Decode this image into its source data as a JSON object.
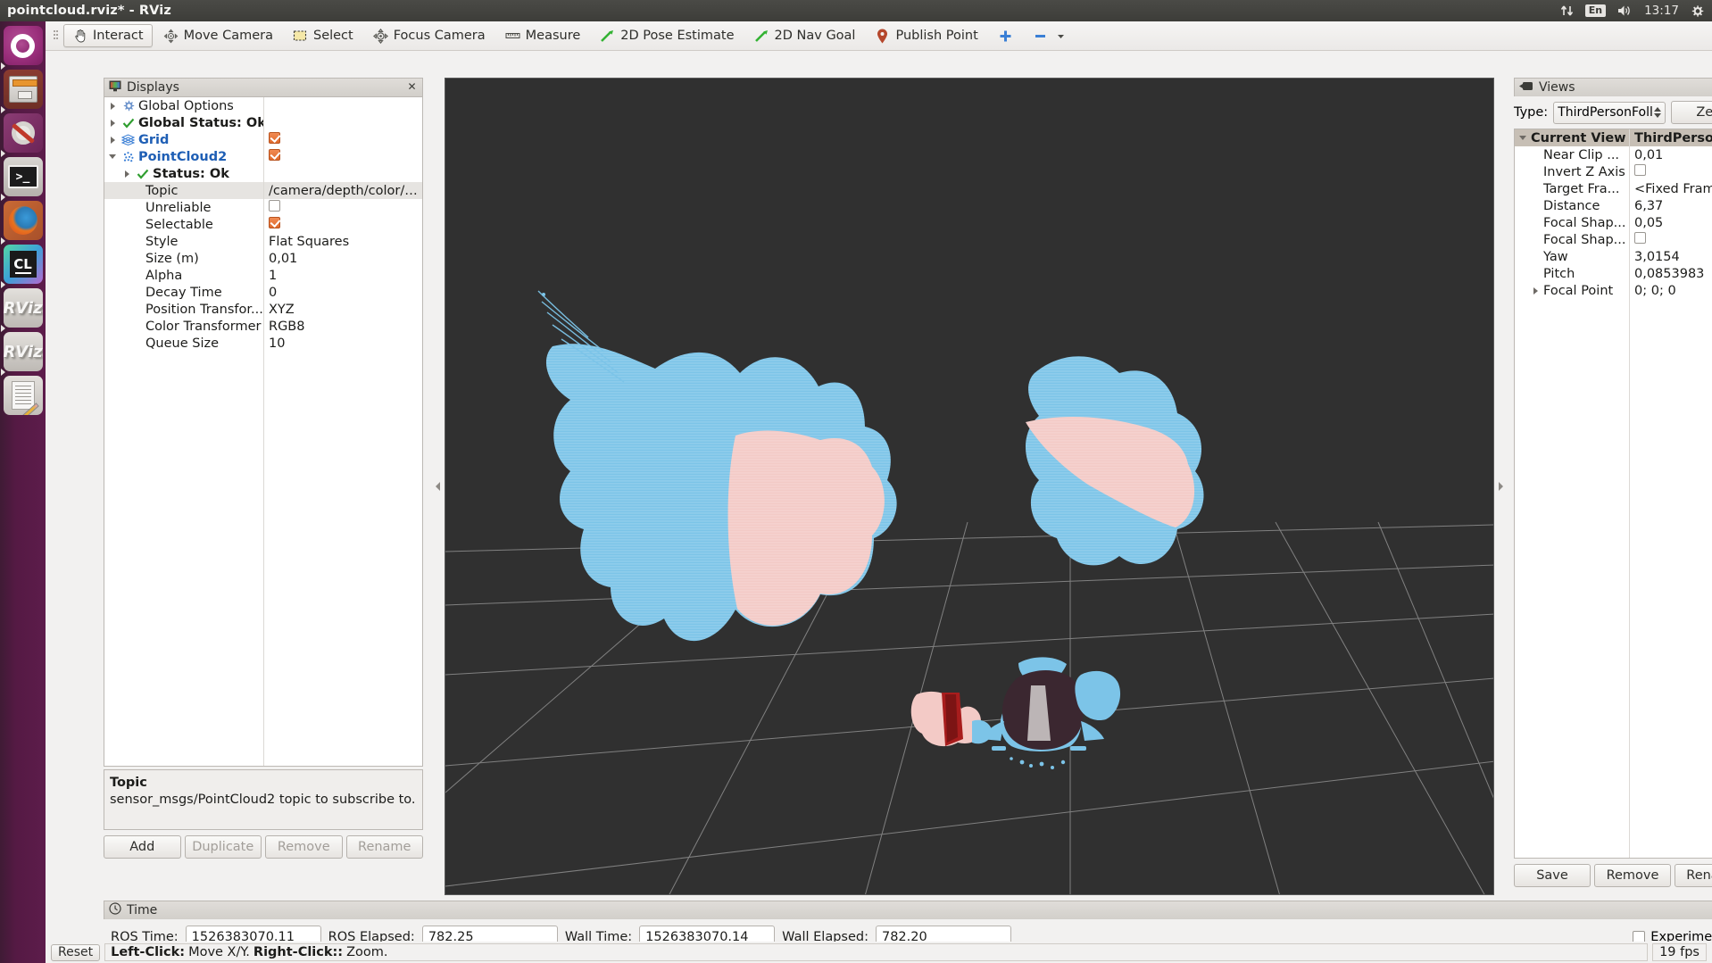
{
  "window": {
    "title": "pointcloud.rviz* - RViz"
  },
  "tray": {
    "network_icon": "network-updown-icon",
    "keyboard_layout": "En",
    "volume_icon": "volume-icon",
    "clock": "13:17",
    "gear_icon": "system-gear-icon"
  },
  "launcher": {
    "items": [
      {
        "name": "ubuntu-dash",
        "label": "Ubuntu"
      },
      {
        "name": "files",
        "label": "Files"
      },
      {
        "name": "system-settings",
        "label": "System Settings"
      },
      {
        "name": "terminal",
        "label": "Terminal"
      },
      {
        "name": "firefox",
        "label": "Firefox"
      },
      {
        "name": "clion",
        "label": "CLion"
      },
      {
        "name": "rviz-1",
        "label": "RViz"
      },
      {
        "name": "rviz-2",
        "label": "RViz"
      },
      {
        "name": "text-editor",
        "label": "Text Editor"
      }
    ]
  },
  "toolbar": {
    "buttons": [
      {
        "label": "Interact",
        "icon": "hand-cursor-icon",
        "active": true
      },
      {
        "label": "Move Camera",
        "icon": "move-camera-icon",
        "active": false
      },
      {
        "label": "Select",
        "icon": "select-rect-icon",
        "active": false
      },
      {
        "label": "Focus Camera",
        "icon": "focus-camera-icon",
        "active": false
      },
      {
        "label": "Measure",
        "icon": "ruler-icon",
        "active": false
      },
      {
        "label": "2D Pose Estimate",
        "icon": "green-arrow-icon",
        "active": false
      },
      {
        "label": "2D Nav Goal",
        "icon": "green-arrow-icon",
        "active": false
      },
      {
        "label": "Publish Point",
        "icon": "map-pin-icon",
        "active": false
      }
    ],
    "add_tool_label": "+",
    "remove_tool_label": "–",
    "overflow_label": "▾"
  },
  "displays": {
    "title": "Displays",
    "title_icon": "displays-monitor-icon",
    "close_icon": "close-icon",
    "rows": [
      {
        "name": "Global Options",
        "value": "",
        "tri": "closed",
        "icon": "gear-icon",
        "indent": 0,
        "style": "plain",
        "check": "none",
        "selected": false
      },
      {
        "name": "Global Status: Ok",
        "value": "",
        "tri": "closed",
        "icon": "check-icon",
        "indent": 0,
        "style": "bold",
        "check": "none",
        "selected": false
      },
      {
        "name": "Grid",
        "value": "",
        "tri": "closed",
        "icon": "grid-icon",
        "indent": 0,
        "style": "blue",
        "check": "on",
        "selected": false
      },
      {
        "name": "PointCloud2",
        "value": "",
        "tri": "open",
        "icon": "pointcloud-icon",
        "indent": 0,
        "style": "blue",
        "check": "on",
        "selected": false
      },
      {
        "name": "Status: Ok",
        "value": "",
        "tri": "closed",
        "icon": "check-icon",
        "indent": 1,
        "style": "bold",
        "check": "none",
        "selected": false
      },
      {
        "name": "Topic",
        "value": "/camera/depth/color/p...",
        "tri": "none",
        "icon": "",
        "indent": 1,
        "style": "plain",
        "check": "none",
        "selected": true
      },
      {
        "name": "Unreliable",
        "value": "",
        "tri": "none",
        "icon": "",
        "indent": 1,
        "style": "plain",
        "check": "off",
        "selected": false
      },
      {
        "name": "Selectable",
        "value": "",
        "tri": "none",
        "icon": "",
        "indent": 1,
        "style": "plain",
        "check": "on",
        "selected": false
      },
      {
        "name": "Style",
        "value": "Flat Squares",
        "tri": "none",
        "icon": "",
        "indent": 1,
        "style": "plain",
        "check": "none",
        "selected": false
      },
      {
        "name": "Size (m)",
        "value": "0,01",
        "tri": "none",
        "icon": "",
        "indent": 1,
        "style": "plain",
        "check": "none",
        "selected": false
      },
      {
        "name": "Alpha",
        "value": "1",
        "tri": "none",
        "icon": "",
        "indent": 1,
        "style": "plain",
        "check": "none",
        "selected": false
      },
      {
        "name": "Decay Time",
        "value": "0",
        "tri": "none",
        "icon": "",
        "indent": 1,
        "style": "plain",
        "check": "none",
        "selected": false
      },
      {
        "name": "Position Transfor...",
        "value": "XYZ",
        "tri": "none",
        "icon": "",
        "indent": 1,
        "style": "plain",
        "check": "none",
        "selected": false
      },
      {
        "name": "Color Transformer",
        "value": "RGB8",
        "tri": "none",
        "icon": "",
        "indent": 1,
        "style": "plain",
        "check": "none",
        "selected": false
      },
      {
        "name": "Queue Size",
        "value": "10",
        "tri": "none",
        "icon": "",
        "indent": 1,
        "style": "plain",
        "check": "none",
        "selected": false
      }
    ],
    "help_title": "Topic",
    "help_body": "sensor_msgs/PointCloud2 topic to subscribe to.",
    "buttons": [
      {
        "label": "Add",
        "enabled": true
      },
      {
        "label": "Duplicate",
        "enabled": false
      },
      {
        "label": "Remove",
        "enabled": false
      },
      {
        "label": "Rename",
        "enabled": false
      }
    ]
  },
  "views": {
    "title": "Views",
    "title_icon": "camera-icon",
    "close_icon": "close-icon",
    "type_label": "Type:",
    "type_value": "ThirdPersonFoll",
    "zero_label": "Zero",
    "header": {
      "name": "Current View",
      "value": "ThirdPersonFol..."
    },
    "rows": [
      {
        "name": "Near Clip ...",
        "value": "0,01",
        "tri": "none",
        "check": "none"
      },
      {
        "name": "Invert Z Axis",
        "value": "",
        "tri": "none",
        "check": "off"
      },
      {
        "name": "Target Fra...",
        "value": "<Fixed Frame>",
        "tri": "none",
        "check": "none"
      },
      {
        "name": "Distance",
        "value": "6,37",
        "tri": "none",
        "check": "none"
      },
      {
        "name": "Focal Shap...",
        "value": "0,05",
        "tri": "none",
        "check": "none"
      },
      {
        "name": "Focal Shap...",
        "value": "",
        "tri": "none",
        "check": "off"
      },
      {
        "name": "Yaw",
        "value": "3,0154",
        "tri": "none",
        "check": "none"
      },
      {
        "name": "Pitch",
        "value": "0,0853983",
        "tri": "none",
        "check": "none"
      },
      {
        "name": "Focal Point",
        "value": "0; 0; 0",
        "tri": "closed",
        "check": "none"
      }
    ],
    "buttons": [
      {
        "label": "Save"
      },
      {
        "label": "Remove"
      },
      {
        "label": "Rename"
      }
    ]
  },
  "time": {
    "title": "Time",
    "title_icon": "clock-icon",
    "close_icon": "close-icon",
    "fields": [
      {
        "label": "ROS Time:",
        "value": "1526383070.11"
      },
      {
        "label": "ROS Elapsed:",
        "value": "782.25"
      },
      {
        "label": "Wall Time:",
        "value": "1526383070.14"
      },
      {
        "label": "Wall Elapsed:",
        "value": "782.20"
      }
    ],
    "experimental_label": "Experimental",
    "experimental_checked": false
  },
  "statusbar": {
    "reset_label": "Reset",
    "hint_prefix": "Left-Click:",
    "hint_mid": " Move X/Y. ",
    "hint_prefix2": "Right-Click::",
    "hint_end": " Zoom.",
    "fps": "19 fps"
  },
  "viewport": {
    "background_color": "#303030",
    "grid_color": "#9a9a9a",
    "cloud_colors": {
      "blue": "#78c2e8",
      "pink": "#f2c8c4",
      "red": "#b02020",
      "dark": "#3b2830"
    }
  }
}
